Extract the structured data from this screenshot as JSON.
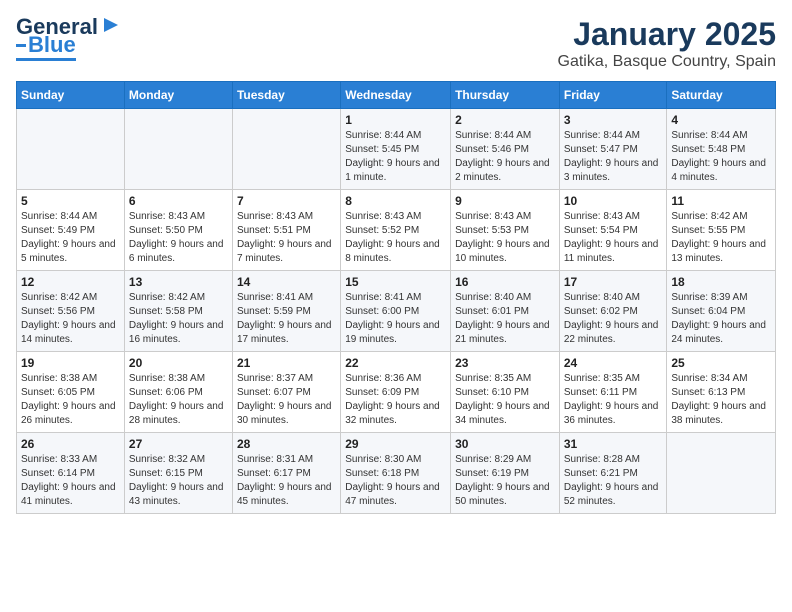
{
  "logo": {
    "line1": "General",
    "line2": "Blue"
  },
  "title": "January 2025",
  "subtitle": "Gatika, Basque Country, Spain",
  "days_of_week": [
    "Sunday",
    "Monday",
    "Tuesday",
    "Wednesday",
    "Thursday",
    "Friday",
    "Saturday"
  ],
  "weeks": [
    [
      {
        "num": "",
        "info": ""
      },
      {
        "num": "",
        "info": ""
      },
      {
        "num": "",
        "info": ""
      },
      {
        "num": "1",
        "info": "Sunrise: 8:44 AM\nSunset: 5:45 PM\nDaylight: 9 hours and 1 minute."
      },
      {
        "num": "2",
        "info": "Sunrise: 8:44 AM\nSunset: 5:46 PM\nDaylight: 9 hours and 2 minutes."
      },
      {
        "num": "3",
        "info": "Sunrise: 8:44 AM\nSunset: 5:47 PM\nDaylight: 9 hours and 3 minutes."
      },
      {
        "num": "4",
        "info": "Sunrise: 8:44 AM\nSunset: 5:48 PM\nDaylight: 9 hours and 4 minutes."
      }
    ],
    [
      {
        "num": "5",
        "info": "Sunrise: 8:44 AM\nSunset: 5:49 PM\nDaylight: 9 hours and 5 minutes."
      },
      {
        "num": "6",
        "info": "Sunrise: 8:43 AM\nSunset: 5:50 PM\nDaylight: 9 hours and 6 minutes."
      },
      {
        "num": "7",
        "info": "Sunrise: 8:43 AM\nSunset: 5:51 PM\nDaylight: 9 hours and 7 minutes."
      },
      {
        "num": "8",
        "info": "Sunrise: 8:43 AM\nSunset: 5:52 PM\nDaylight: 9 hours and 8 minutes."
      },
      {
        "num": "9",
        "info": "Sunrise: 8:43 AM\nSunset: 5:53 PM\nDaylight: 9 hours and 10 minutes."
      },
      {
        "num": "10",
        "info": "Sunrise: 8:43 AM\nSunset: 5:54 PM\nDaylight: 9 hours and 11 minutes."
      },
      {
        "num": "11",
        "info": "Sunrise: 8:42 AM\nSunset: 5:55 PM\nDaylight: 9 hours and 13 minutes."
      }
    ],
    [
      {
        "num": "12",
        "info": "Sunrise: 8:42 AM\nSunset: 5:56 PM\nDaylight: 9 hours and 14 minutes."
      },
      {
        "num": "13",
        "info": "Sunrise: 8:42 AM\nSunset: 5:58 PM\nDaylight: 9 hours and 16 minutes."
      },
      {
        "num": "14",
        "info": "Sunrise: 8:41 AM\nSunset: 5:59 PM\nDaylight: 9 hours and 17 minutes."
      },
      {
        "num": "15",
        "info": "Sunrise: 8:41 AM\nSunset: 6:00 PM\nDaylight: 9 hours and 19 minutes."
      },
      {
        "num": "16",
        "info": "Sunrise: 8:40 AM\nSunset: 6:01 PM\nDaylight: 9 hours and 21 minutes."
      },
      {
        "num": "17",
        "info": "Sunrise: 8:40 AM\nSunset: 6:02 PM\nDaylight: 9 hours and 22 minutes."
      },
      {
        "num": "18",
        "info": "Sunrise: 8:39 AM\nSunset: 6:04 PM\nDaylight: 9 hours and 24 minutes."
      }
    ],
    [
      {
        "num": "19",
        "info": "Sunrise: 8:38 AM\nSunset: 6:05 PM\nDaylight: 9 hours and 26 minutes."
      },
      {
        "num": "20",
        "info": "Sunrise: 8:38 AM\nSunset: 6:06 PM\nDaylight: 9 hours and 28 minutes."
      },
      {
        "num": "21",
        "info": "Sunrise: 8:37 AM\nSunset: 6:07 PM\nDaylight: 9 hours and 30 minutes."
      },
      {
        "num": "22",
        "info": "Sunrise: 8:36 AM\nSunset: 6:09 PM\nDaylight: 9 hours and 32 minutes."
      },
      {
        "num": "23",
        "info": "Sunrise: 8:35 AM\nSunset: 6:10 PM\nDaylight: 9 hours and 34 minutes."
      },
      {
        "num": "24",
        "info": "Sunrise: 8:35 AM\nSunset: 6:11 PM\nDaylight: 9 hours and 36 minutes."
      },
      {
        "num": "25",
        "info": "Sunrise: 8:34 AM\nSunset: 6:13 PM\nDaylight: 9 hours and 38 minutes."
      }
    ],
    [
      {
        "num": "26",
        "info": "Sunrise: 8:33 AM\nSunset: 6:14 PM\nDaylight: 9 hours and 41 minutes."
      },
      {
        "num": "27",
        "info": "Sunrise: 8:32 AM\nSunset: 6:15 PM\nDaylight: 9 hours and 43 minutes."
      },
      {
        "num": "28",
        "info": "Sunrise: 8:31 AM\nSunset: 6:17 PM\nDaylight: 9 hours and 45 minutes."
      },
      {
        "num": "29",
        "info": "Sunrise: 8:30 AM\nSunset: 6:18 PM\nDaylight: 9 hours and 47 minutes."
      },
      {
        "num": "30",
        "info": "Sunrise: 8:29 AM\nSunset: 6:19 PM\nDaylight: 9 hours and 50 minutes."
      },
      {
        "num": "31",
        "info": "Sunrise: 8:28 AM\nSunset: 6:21 PM\nDaylight: 9 hours and 52 minutes."
      },
      {
        "num": "",
        "info": ""
      }
    ]
  ]
}
